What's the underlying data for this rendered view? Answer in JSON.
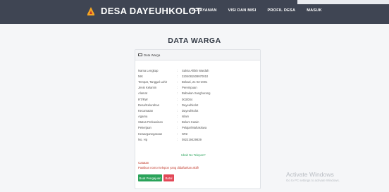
{
  "brand": {
    "name": "DESA DAYEUHKOLOT"
  },
  "nav": {
    "items": [
      "PELAYANAN",
      "VISI DAN MISI",
      "PROFIL DESA",
      "MASUK"
    ]
  },
  "page": {
    "title": "DATA WARGA"
  },
  "card": {
    "header": "Data Warga",
    "rows": [
      {
        "label": "Nama Lengkap",
        "value": "Salvia Alifah Wardah"
      },
      {
        "label": "NIK",
        "value": "3204081509970010"
      },
      {
        "label": "Tempat, Tanggal Lahir",
        "value": "Bekasi, 21-02-2001"
      },
      {
        "label": "Jenis Kelamin",
        "value": "Perempuan"
      },
      {
        "label": "Alamat",
        "value": "Babakan Sanghurang"
      },
      {
        "label": "RT/RW",
        "value": "003/004"
      },
      {
        "label": "Desa/Kelurahan",
        "value": "Dayeuhkolot"
      },
      {
        "label": "Kecamatan",
        "value": "Dayeuhkolot"
      },
      {
        "label": "Agama",
        "value": "Islam"
      },
      {
        "label": "Status Perkawinan",
        "value": "Belum Kawin"
      },
      {
        "label": "Pekerjaan",
        "value": "Pelajar/Mahasiswa"
      },
      {
        "label": "Kewarganegaraan",
        "value": "WNI"
      },
      {
        "label": "No. Hp",
        "value": "082219429839"
      }
    ],
    "separator": ":",
    "update_link": "Ubah No Telepon?",
    "note_label": "Catatan",
    "note_text": "Pastikan nomor telepon yang didaftarkan aktif!",
    "buttons": {
      "primary": "Buat Pengajuan",
      "danger": "Batal"
    }
  },
  "watermark": {
    "title": "Activate Windows",
    "subtitle": "Go to PC settings to activate Windows."
  },
  "colors": {
    "navbar": "#3f4553",
    "success": "#2aa35a",
    "danger": "#e24857"
  }
}
